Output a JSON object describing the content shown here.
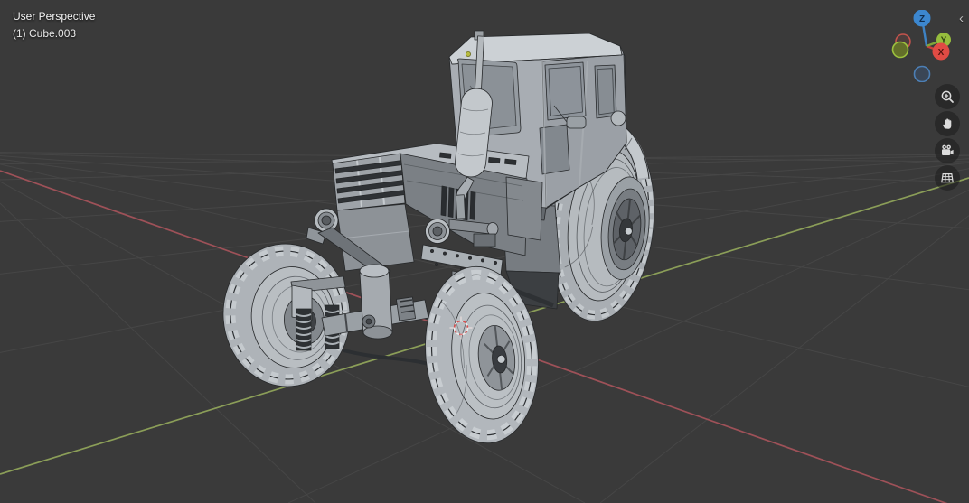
{
  "header": {
    "view_label": "User Perspective",
    "object_label": "(1) Cube.003"
  },
  "gizmo": {
    "axis_labels": {
      "x": "X",
      "y": "Y",
      "z": "Z"
    },
    "colors": {
      "x_positive": "#e04b44",
      "y_positive": "#96bd3d",
      "z_positive": "#3c87cf"
    }
  },
  "toolbar": {
    "buttons": [
      {
        "icon": "zoom-in-magnifier"
      },
      {
        "icon": "pan-hand"
      },
      {
        "icon": "camera-view"
      },
      {
        "icon": "toggle-perspective-grid"
      }
    ]
  },
  "sidebar_toggle": {
    "symbol": "‹"
  },
  "scene": {
    "background_color": "#3a3a3a",
    "grid_line_color": "#464646",
    "axis_line_colors": {
      "x": "#9e5158",
      "y": "#8b9e58"
    }
  }
}
